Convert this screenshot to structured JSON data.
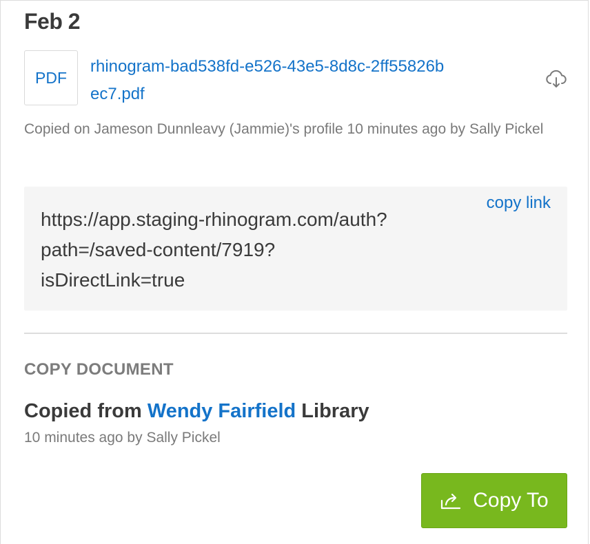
{
  "date_heading": "Feb 2",
  "file": {
    "type_badge": "PDF",
    "name": "rhinogram-bad538fd-e526-43e5-8d8c-2ff55826bec7.pdf",
    "meta": "Copied on Jameson Dunnleavy (Jammie)'s profile 10 minutes ago by Sally Pickel",
    "download_icon": "cloud-download-icon"
  },
  "link_box": {
    "url": "https://app.staging-rhinogram.com/auth?path=/saved-content/7919?isDirectLink=true",
    "copy_label": "copy link"
  },
  "copy_document": {
    "section_label": "COPY DOCUMENT",
    "prefix": "Copied from ",
    "library_owner": "Wendy Fairfield",
    "suffix": " Library",
    "time_meta": "10 minutes ago by Sally Pickel"
  },
  "actions": {
    "copy_to_label": "Copy To",
    "copy_to_icon": "share-arrow-icon"
  },
  "colors": {
    "link_blue": "#1473c9",
    "button_green": "#78b81e",
    "muted_text": "#7a7a7a",
    "dark_text": "#3a3a3a"
  }
}
